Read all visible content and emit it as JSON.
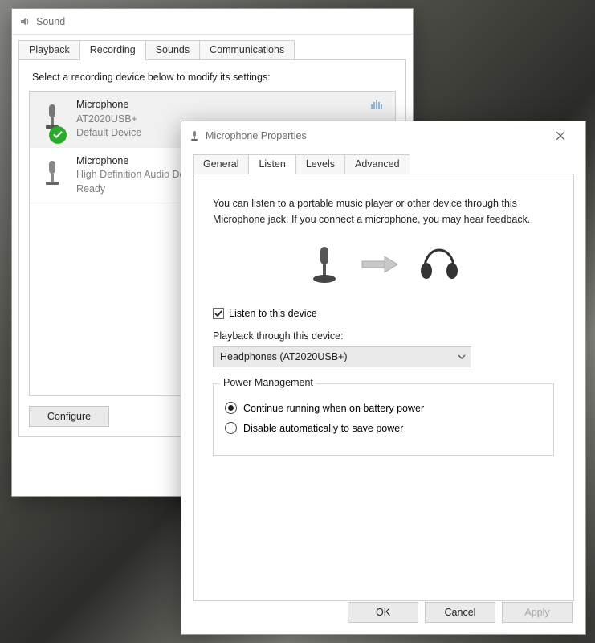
{
  "sound_window": {
    "title": "Sound",
    "tabs": [
      "Playback",
      "Recording",
      "Sounds",
      "Communications"
    ],
    "active_tab": 1,
    "prompt": "Select a recording device below to modify its settings:",
    "devices": [
      {
        "name": "Microphone",
        "line2": "AT2020USB+",
        "line3": "Default Device",
        "selected": true,
        "has_check": true,
        "has_level_meter": true
      },
      {
        "name": "Microphone",
        "line2": "High Definition Audio De",
        "line3": "Ready",
        "selected": false,
        "has_check": false,
        "has_level_meter": false
      }
    ],
    "configure_label": "Configure"
  },
  "props_window": {
    "title": "Microphone Properties",
    "tabs": [
      "General",
      "Listen",
      "Levels",
      "Advanced"
    ],
    "active_tab": 1,
    "listen": {
      "description": "You can listen to a portable music player or other device through this Microphone jack.  If you connect a microphone, you may hear feedback.",
      "checkbox_label": "Listen to this device",
      "checkbox_checked": true,
      "playback_label": "Playback through this device:",
      "playback_value": "Headphones (AT2020USB+)",
      "power_legend": "Power Management",
      "power_options": [
        {
          "label": "Continue running when on battery power",
          "checked": true
        },
        {
          "label": "Disable automatically to save power",
          "checked": false
        }
      ]
    },
    "buttons": {
      "ok": "OK",
      "cancel": "Cancel",
      "apply": "Apply"
    }
  }
}
